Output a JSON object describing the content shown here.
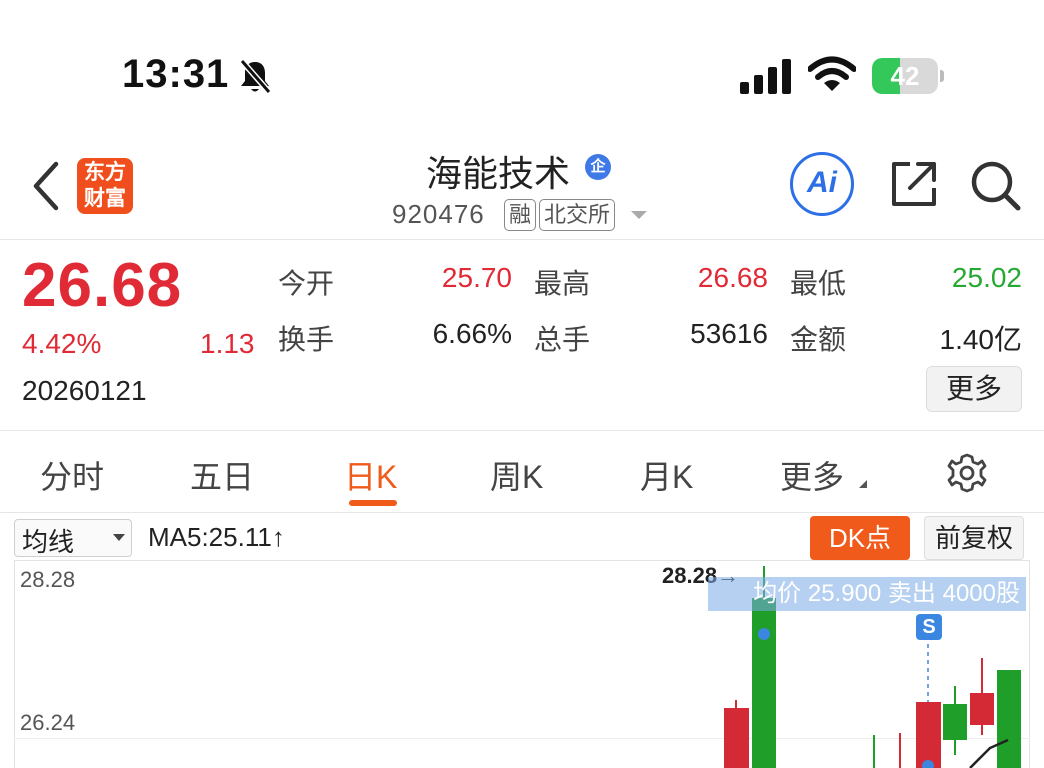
{
  "status_bar": {
    "time": "13:31",
    "battery": "42",
    "battery_level_pct": 42
  },
  "header": {
    "logo_text_line1": "东方",
    "logo_text_line2": "财富",
    "stock_name": "海能技术",
    "corp_badge": "企",
    "code": "920476",
    "tag_margin": "融",
    "tag_exchange": "北交所",
    "ai_label": "Ai"
  },
  "quote": {
    "price": "26.68",
    "change_pct": "4.42%",
    "change": "1.13",
    "date": "20260121",
    "open_label": "今开",
    "open": "25.70",
    "high_label": "最高",
    "high": "26.68",
    "low_label": "最低",
    "low": "25.02",
    "turnover_label": "换手",
    "turnover": "6.66%",
    "volume_label": "总手",
    "volume": "53616",
    "amount_label": "金额",
    "amount": "1.40亿",
    "more_label": "更多"
  },
  "tabs": [
    {
      "label": "分时",
      "active": false
    },
    {
      "label": "五日",
      "active": false
    },
    {
      "label": "日K",
      "active": true
    },
    {
      "label": "周K",
      "active": false
    },
    {
      "label": "月K",
      "active": false
    },
    {
      "label": "更多",
      "active": false
    }
  ],
  "chart_toolbar": {
    "indicator_select": "均线",
    "ma5": "MA5:25.11↑",
    "dk_button": "DK点",
    "adjust_button": "前复权"
  },
  "chart": {
    "y_top_label": "28.28",
    "y_mid_label": "26.24",
    "high_label": "28.28→",
    "trade_tip": "均价 25.900 卖出 4000股",
    "sell_marker": "S"
  },
  "colors": {
    "up": "#e02a36",
    "down": "#26a832",
    "accent": "#f05a1a",
    "ai_blue": "#2d6fe6"
  }
}
